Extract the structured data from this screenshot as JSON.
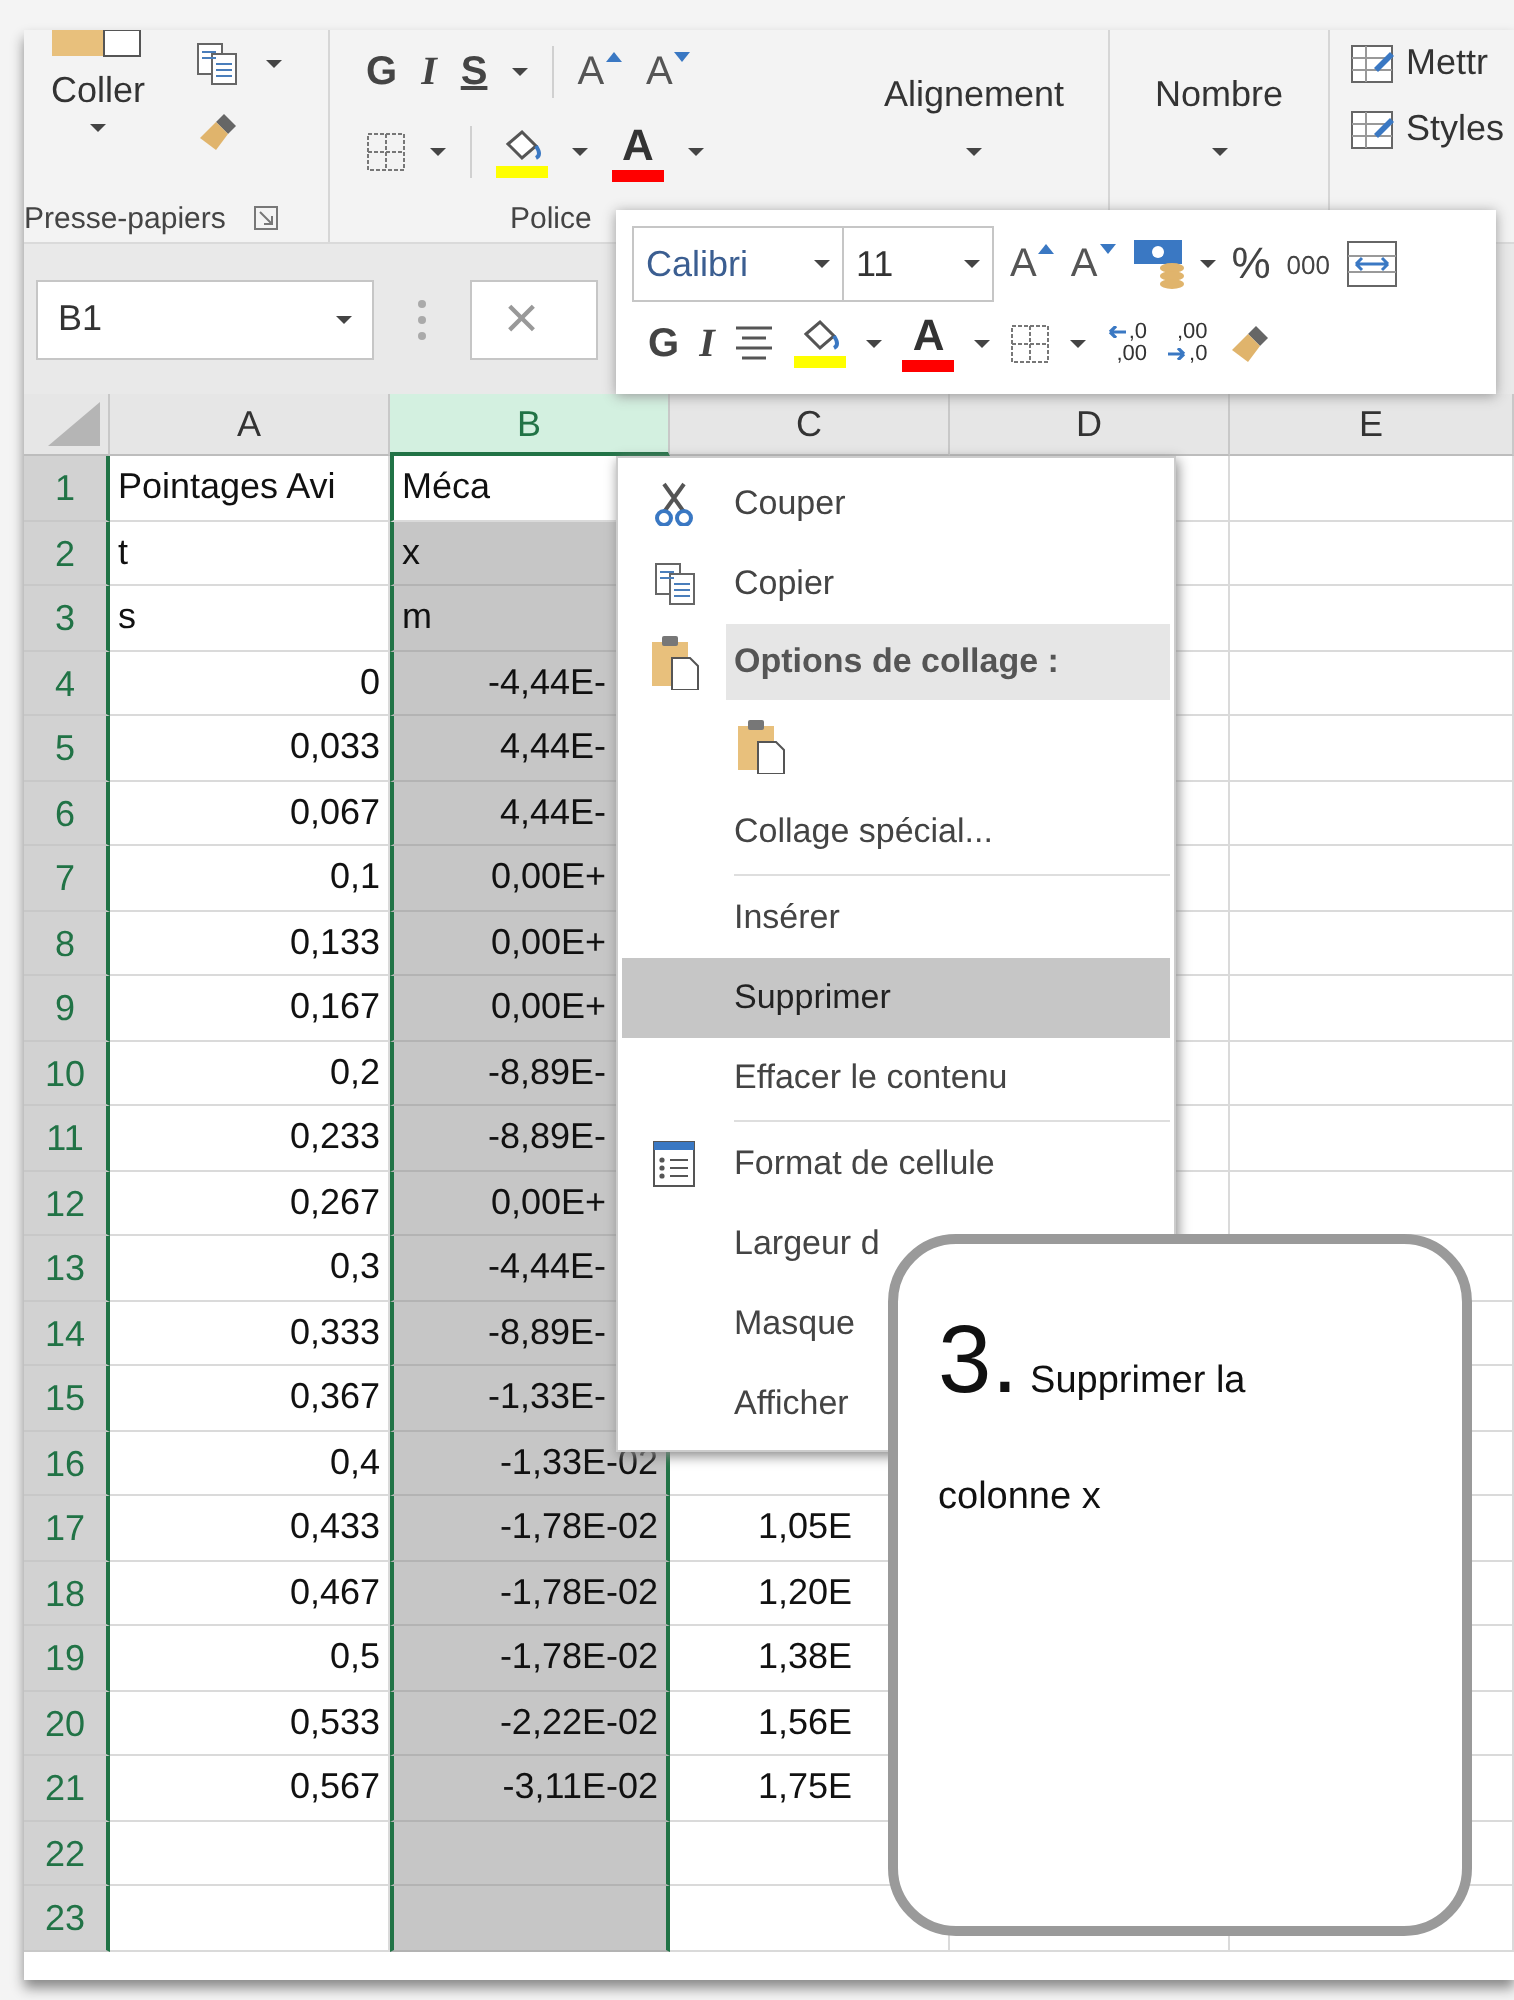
{
  "ribbon": {
    "clipboard": {
      "paste_label": "Coller",
      "group_label": "Presse-papiers"
    },
    "font": {
      "bold": "G",
      "italic": "I",
      "underline": "S",
      "grow": "A",
      "shrink": "A",
      "color_letter": "A",
      "group_label": "Police"
    },
    "alignment": {
      "label": "Alignement"
    },
    "number": {
      "label": "Nombre"
    },
    "styles": {
      "items": [
        "Mettr",
        "Styles"
      ]
    }
  },
  "formula_bar": {
    "name_box": "B1",
    "cancel": "×"
  },
  "mini_toolbar": {
    "font": "Calibri",
    "size": "11",
    "grow": "A",
    "shrink": "A",
    "percent": "%",
    "thousands": "000",
    "bold": "G",
    "italic": "I",
    "color_letter": "A",
    "add_decimal": [
      ",0",
      ",00"
    ],
    "remove_decimal": [
      ",00",
      ",0"
    ]
  },
  "grid": {
    "columns": [
      {
        "label": "A",
        "selected": false
      },
      {
        "label": "B",
        "selected": true
      },
      {
        "label": "C",
        "selected": false
      },
      {
        "label": "D",
        "selected": false
      },
      {
        "label": "E",
        "selected": false
      }
    ],
    "rows": [
      {
        "number": "1",
        "kind": "text",
        "a": "Pointages Avi",
        "b": "Méca",
        "active": true
      },
      {
        "number": "2",
        "kind": "text",
        "a": "t",
        "b": "x",
        "active": false
      },
      {
        "number": "3",
        "kind": "text",
        "a": "s",
        "b": "m",
        "active": false
      },
      {
        "number": "4",
        "kind": "number",
        "a": "0",
        "b": "-4,44E-",
        "active": false
      },
      {
        "number": "5",
        "kind": "number",
        "a": "0,033",
        "b": "4,44E-",
        "active": false
      },
      {
        "number": "6",
        "kind": "number",
        "a": "0,067",
        "b": "4,44E-",
        "active": false
      },
      {
        "number": "7",
        "kind": "number",
        "a": "0,1",
        "b": "0,00E+",
        "active": false
      },
      {
        "number": "8",
        "kind": "number",
        "a": "0,133",
        "b": "0,00E+",
        "active": false
      },
      {
        "number": "9",
        "kind": "number",
        "a": "0,167",
        "b": "0,00E+",
        "active": false
      },
      {
        "number": "10",
        "kind": "number",
        "a": "0,2",
        "b": "-8,89E-",
        "active": false
      },
      {
        "number": "11",
        "kind": "number",
        "a": "0,233",
        "b": "-8,89E-",
        "active": false
      },
      {
        "number": "12",
        "kind": "number",
        "a": "0,267",
        "b": "0,00E+",
        "active": false
      },
      {
        "number": "13",
        "kind": "number",
        "a": "0,3",
        "b": "-4,44E-",
        "active": false
      },
      {
        "number": "14",
        "kind": "number",
        "a": "0,333",
        "b": "-8,89E-",
        "active": false
      },
      {
        "number": "15",
        "kind": "number",
        "a": "0,367",
        "b": "-1,33E-",
        "active": false
      },
      {
        "number": "16",
        "kind": "number",
        "a": "0,4",
        "b": "-1,33E-02",
        "active": false
      },
      {
        "number": "17",
        "kind": "number",
        "a": "0,433",
        "b": "-1,78E-02",
        "c": "1,05E",
        "active": false
      },
      {
        "number": "18",
        "kind": "number",
        "a": "0,467",
        "b": "-1,78E-02",
        "c": "1,20E",
        "active": false
      },
      {
        "number": "19",
        "kind": "number",
        "a": "0,5",
        "b": "-1,78E-02",
        "c": "1,38E",
        "active": false
      },
      {
        "number": "20",
        "kind": "number",
        "a": "0,533",
        "b": "-2,22E-02",
        "c": "1,56E",
        "active": false
      },
      {
        "number": "21",
        "kind": "number",
        "a": "0,567",
        "b": "-3,11E-02",
        "c": "1,75E",
        "active": false
      },
      {
        "number": "22",
        "kind": "number",
        "active": false
      },
      {
        "number": "23",
        "kind": "number",
        "active": false
      }
    ]
  },
  "context_menu": {
    "items": [
      {
        "kind": "command",
        "label": "Couper",
        "selected": false
      },
      {
        "kind": "command",
        "label": "Copier",
        "selected": false
      },
      {
        "kind": "header",
        "label": "Options de collage :"
      },
      {
        "kind": "paste-option"
      },
      {
        "kind": "command",
        "label": "Collage spécial...",
        "selected": false
      },
      {
        "kind": "separator"
      },
      {
        "kind": "command",
        "label": "Insérer",
        "selected": false
      },
      {
        "kind": "command",
        "label": "Supprimer",
        "selected": true
      },
      {
        "kind": "command",
        "label": "Effacer le contenu",
        "selected": false
      },
      {
        "kind": "separator"
      },
      {
        "kind": "command",
        "label": "Format de cellule",
        "selected": false
      },
      {
        "kind": "command",
        "label": "Largeur d",
        "selected": false
      },
      {
        "kind": "command",
        "label": "Masque",
        "selected": false
      },
      {
        "kind": "command",
        "label": "Afficher",
        "selected": false
      }
    ]
  },
  "callout": {
    "step": "3.",
    "text": "Supprimer la colonne x"
  }
}
